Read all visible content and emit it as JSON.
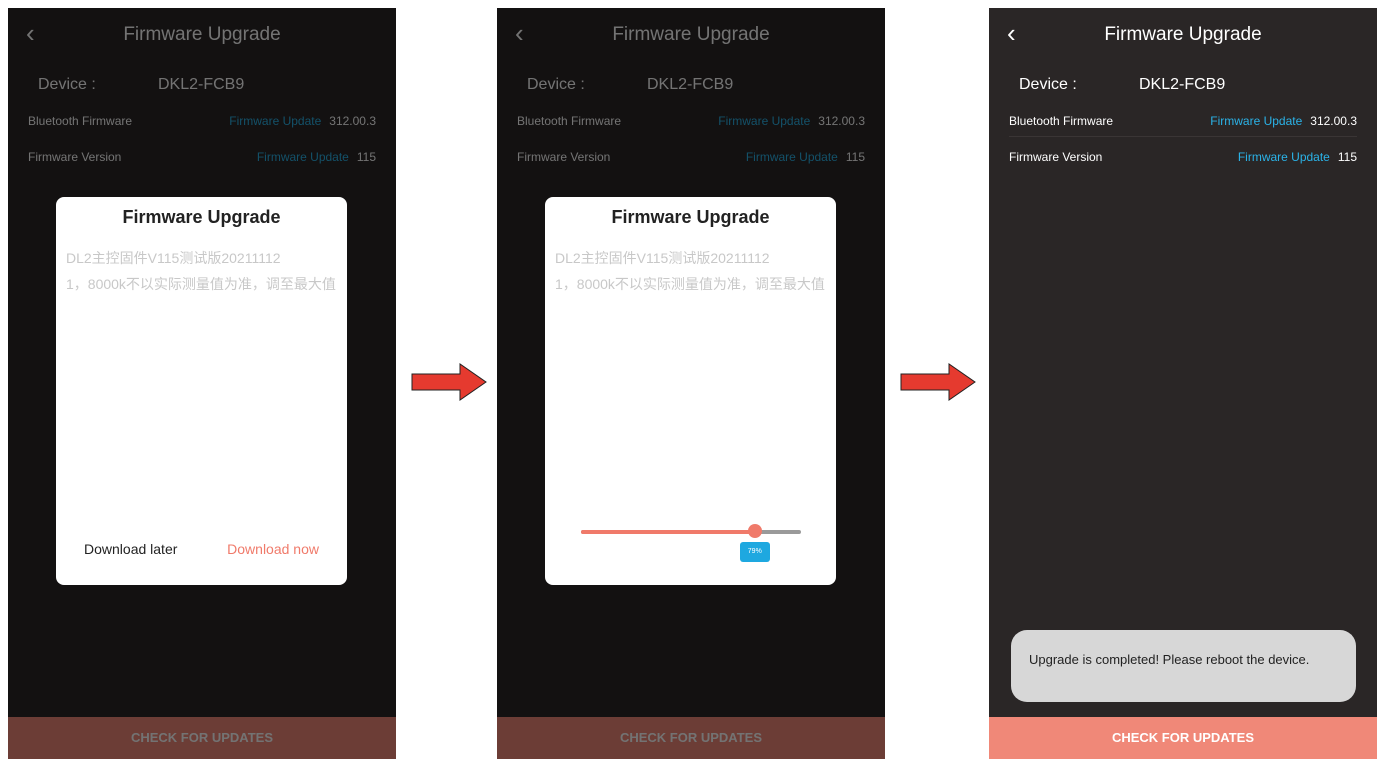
{
  "screen": {
    "title": "Firmware Upgrade",
    "back_icon": "‹",
    "device_label": "Device :",
    "device_name": "DKL2-FCB9",
    "bluetooth_label": "Bluetooth Firmware",
    "bluetooth_link": "Firmware Update",
    "bluetooth_version": "312.00.3",
    "firmware_label": "Firmware Version",
    "firmware_link": "Firmware Update",
    "firmware_version": "115",
    "check_button": "CHECK FOR UPDATES"
  },
  "dialog": {
    "title": "Firmware Upgrade",
    "line1": "DL2主控固件V115测试版20211112",
    "line2": "1，8000k不以实际测量值为准，调至最大值",
    "download_later": "Download later",
    "download_now": "Download now"
  },
  "progress": {
    "value": 0.79,
    "label": "79%"
  },
  "toast": {
    "message": "Upgrade is completed! Please reboot the device."
  },
  "colors": {
    "screen_bg": "#2a2626",
    "accent": "#f08878",
    "link": "#2bb3e8",
    "arrow": "#e53a2f"
  },
  "icons": {
    "back": "chevron-left-icon",
    "flow_arrow": "right-arrow-icon"
  }
}
